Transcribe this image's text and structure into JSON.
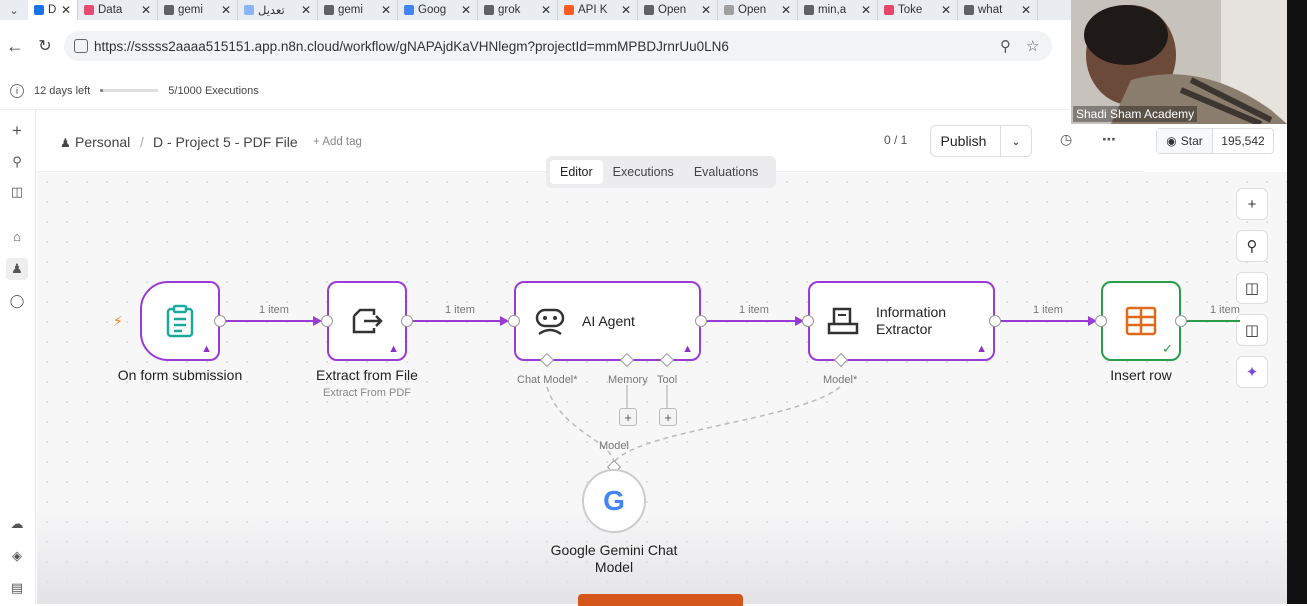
{
  "tabs": [
    {
      "label": "D",
      "color": "#1a73e8",
      "active": true
    },
    {
      "label": "Data",
      "color": "#ea4b71"
    },
    {
      "label": "gemi",
      "color": "#5f6368"
    },
    {
      "label": "تعديل",
      "color": "#8ab4f8"
    },
    {
      "label": "gemi",
      "color": "#5f6368"
    },
    {
      "label": "Goog",
      "color": "#4285f4"
    },
    {
      "label": "grok",
      "color": "#5f6368"
    },
    {
      "label": "API K",
      "color": "#ff5b22"
    },
    {
      "label": "Open",
      "color": "#5f6368"
    },
    {
      "label": "Open",
      "color": "#a0a0a0"
    },
    {
      "label": "min,a",
      "color": "#5f6368"
    },
    {
      "label": "Toke",
      "color": "#e9456b"
    },
    {
      "label": "what",
      "color": "#5f6368"
    }
  ],
  "address": {
    "url": "https://sssss2aaaa515151.app.n8n.cloud/workflow/gNAPAjdKaVHNlegm?projectId=mmMPBDJrnrUu0LN6"
  },
  "trial": {
    "days_left": "12 days left",
    "executions": "5/1000 Executions",
    "progress": 0.005
  },
  "header": {
    "breadcrumb_home": "Personal",
    "separator": "/",
    "workflow_name": "D - Project 5 - PDF File",
    "add_tag": "+ Add tag",
    "counter": "0 / 1",
    "publish": "Publish"
  },
  "github": {
    "star": "Star",
    "count": "195,542"
  },
  "view_tabs": [
    "Editor",
    "Executions",
    "Evaluations"
  ],
  "nodes": {
    "trigger": {
      "label": "On form submission"
    },
    "extract": {
      "label": "Extract from File",
      "sub": "Extract From PDF"
    },
    "agent": {
      "label": "AI Agent"
    },
    "info": {
      "label_line1": "Information",
      "label_line2": "Extractor"
    },
    "insert": {
      "label": "Insert row"
    },
    "gemini": {
      "label_line1": "Google Gemini Chat",
      "label_line2": "Model",
      "logo": "G"
    }
  },
  "edges": {
    "item_label": "1 item"
  },
  "ports": {
    "chat_model": "Chat Model*",
    "memory": "Memory",
    "tool": "Tool",
    "model": "Model*",
    "model_plain": "Model"
  },
  "webcam": {
    "name": "Shadi Sham Academy"
  },
  "colors": {
    "node_border": "#9a3bd6",
    "success": "#2a9d4b",
    "trigger_icon": "#1aa99a",
    "connection": "#9a3bd6"
  }
}
